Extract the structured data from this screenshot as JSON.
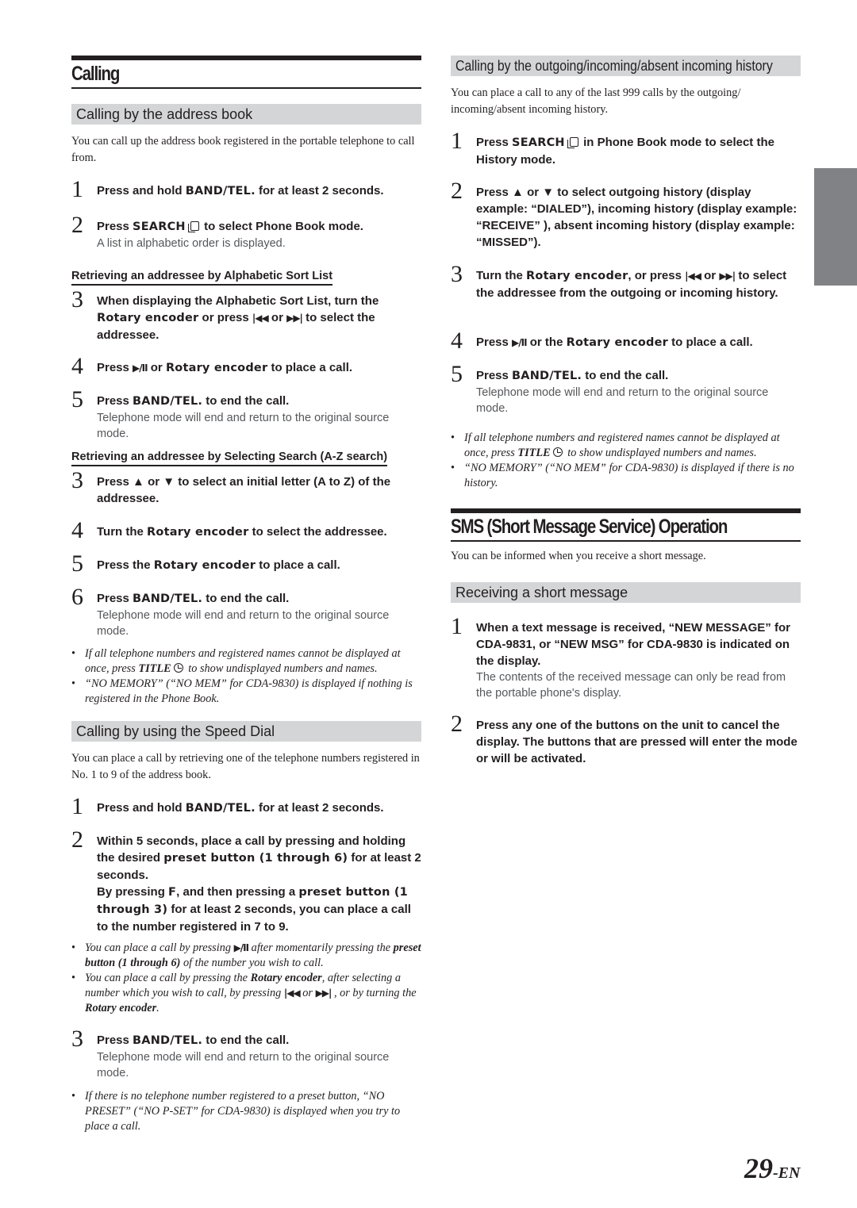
{
  "left": {
    "section_title": "Calling",
    "address_book": {
      "heading": "Calling by the address book",
      "intro": "You can call up the address book registered in the portable telephone to call from.",
      "steps": [
        {
          "num": "1",
          "parts": [
            "Press and hold ",
            "BAND/TEL.",
            " for at least 2 seconds."
          ]
        },
        {
          "num": "2",
          "parts": [
            "Press ",
            "SEARCH",
            " to select Phone Book mode."
          ],
          "note": "A list in alphabetic order is displayed."
        }
      ],
      "alpha_heading": "Retrieving an addressee by Alphabetic Sort List",
      "alpha_steps": [
        {
          "num": "3",
          "parts": [
            "When displaying the Alphabetic Sort List, turn the ",
            "Rotary encoder",
            " or press ",
            "|◀◀",
            " or ",
            "▶▶|",
            " to select the addressee."
          ]
        },
        {
          "num": "4",
          "parts": [
            "Press ",
            "▶/II",
            " or ",
            "Rotary encoder",
            " to place a call."
          ]
        },
        {
          "num": "5",
          "parts": [
            "Press ",
            "BAND/TEL.",
            " to end the call."
          ],
          "note": "Telephone mode will end and return to the original source mode."
        }
      ],
      "az_heading": "Retrieving an addressee by Selecting Search (A-Z search)",
      "az_steps": [
        {
          "num": "3",
          "parts": [
            "Press ",
            "▲",
            " or ",
            "▼",
            " to select an initial letter (A to Z) of the addressee."
          ]
        },
        {
          "num": "4",
          "parts": [
            "Turn the ",
            "Rotary encoder",
            " to select the addressee."
          ]
        },
        {
          "num": "5",
          "parts": [
            "Press the ",
            "Rotary encoder",
            " to place a call."
          ]
        },
        {
          "num": "6",
          "parts": [
            "Press ",
            "BAND/TEL.",
            " to end the call."
          ],
          "note": "Telephone mode will end and return to the original source mode."
        }
      ],
      "bullets": [
        {
          "a": "If all telephone numbers and registered names cannot be displayed at once, press ",
          "b": "TITLE",
          "c": " to show undisplayed numbers and names."
        },
        {
          "a": "“NO MEMORY” (“NO MEM” for CDA-9830) is displayed if nothing is registered in the Phone Book."
        }
      ]
    },
    "speed_dial": {
      "heading": "Calling by using the Speed Dial",
      "intro": "You can place a call by retrieving one of the telephone numbers registered in No. 1 to 9 of the address book.",
      "step1": {
        "num": "1",
        "parts": [
          "Press and hold ",
          "BAND/TEL.",
          " for at least 2 seconds."
        ]
      },
      "step2": {
        "num": "2",
        "parts": [
          "Within 5 seconds, place a call by pressing and holding the desired ",
          "preset button (1 through 6)",
          " for at least 2 seconds."
        ],
        "parts2": [
          "By pressing ",
          "F",
          ", and then pressing a ",
          "preset button (1 through 3)",
          " for at least 2 seconds, you can place a call to the number registered in 7 to 9."
        ]
      },
      "bullets1": [
        {
          "a": "You can place a call by pressing ",
          "sym": "▶/II",
          "b": " after momentarily pressing the ",
          "c": "preset button (1 through 6)",
          "d": " of the number you wish to call."
        },
        {
          "a": "You can place a call by pressing the ",
          "c": "Rotary encoder",
          "b": ", after selecting a number which you wish to call, by pressing ",
          "sym1": "|◀◀",
          "or": " or ",
          "sym2": "▶▶|",
          "d": " , or by turning the ",
          "e": "Rotary encoder",
          "f": "."
        }
      ],
      "step3": {
        "num": "3",
        "parts": [
          "Press ",
          "BAND/TEL.",
          " to end the call."
        ],
        "note": "Telephone mode will end and return to the original source mode."
      },
      "bullets2": [
        {
          "a": "If there is no telephone number registered to a preset button, “NO PRESET” (“NO P-SET” for CDA-9830) is displayed when you try to place a call."
        }
      ]
    }
  },
  "right": {
    "history": {
      "heading": "Calling by the outgoing/incoming/absent incoming history",
      "intro": "You can place a call to any of the last 999 calls by the outgoing/ incoming/absent incoming history.",
      "steps": [
        {
          "num": "1",
          "parts": [
            "Press ",
            "SEARCH",
            " in Phone Book mode to select the History mode."
          ]
        },
        {
          "num": "2",
          "parts": [
            "Press ",
            "▲",
            " or ",
            "▼",
            " to select outgoing history (display example: “DIALED”), incoming history (display example: “RECEIVE” ), absent incoming history (display example: “MISSED”)."
          ]
        },
        {
          "num": "3",
          "parts": [
            "Turn the ",
            "Rotary encoder",
            ", or press ",
            "|◀◀",
            " or ",
            "▶▶|",
            " to select the addressee from the outgoing or incoming history."
          ]
        },
        {
          "num": "4",
          "parts": [
            "Press ",
            "▶/II",
            " or the ",
            "Rotary encoder",
            " to place a call."
          ]
        },
        {
          "num": "5",
          "parts": [
            "Press ",
            "BAND/TEL.",
            " to end the call."
          ],
          "note": "Telephone mode will end and return to the original source mode."
        }
      ],
      "bullets": [
        {
          "a": "If all telephone numbers and registered names cannot be displayed at once, press ",
          "b": "TITLE",
          "c": " to show undisplayed numbers and names."
        },
        {
          "a": "“NO MEMORY” (“NO MEM” for CDA-9830) is displayed if there is no history."
        }
      ]
    },
    "sms": {
      "section_title": "SMS (Short Message Service) Operation",
      "intro": "You can be informed when you receive a short message.",
      "heading": "Receiving a short message",
      "steps": [
        {
          "num": "1",
          "text": "When a text message is received, “NEW MESSAGE” for CDA-9831, or “NEW MSG” for CDA-9830 is indicated on the display.",
          "note": "The contents of the received message can only be read from the portable phone's display."
        },
        {
          "num": "2",
          "text": "Press any one of the buttons on the unit to cancel the display. The buttons that are pressed will enter the mode or will be activated."
        }
      ]
    }
  },
  "page": {
    "number": "29",
    "suffix": "-EN"
  },
  "colors": {
    "text": "#231f20",
    "subhead_bar": "#d4d5d6",
    "side_tab": "#808285",
    "note_text": "#55575a"
  }
}
